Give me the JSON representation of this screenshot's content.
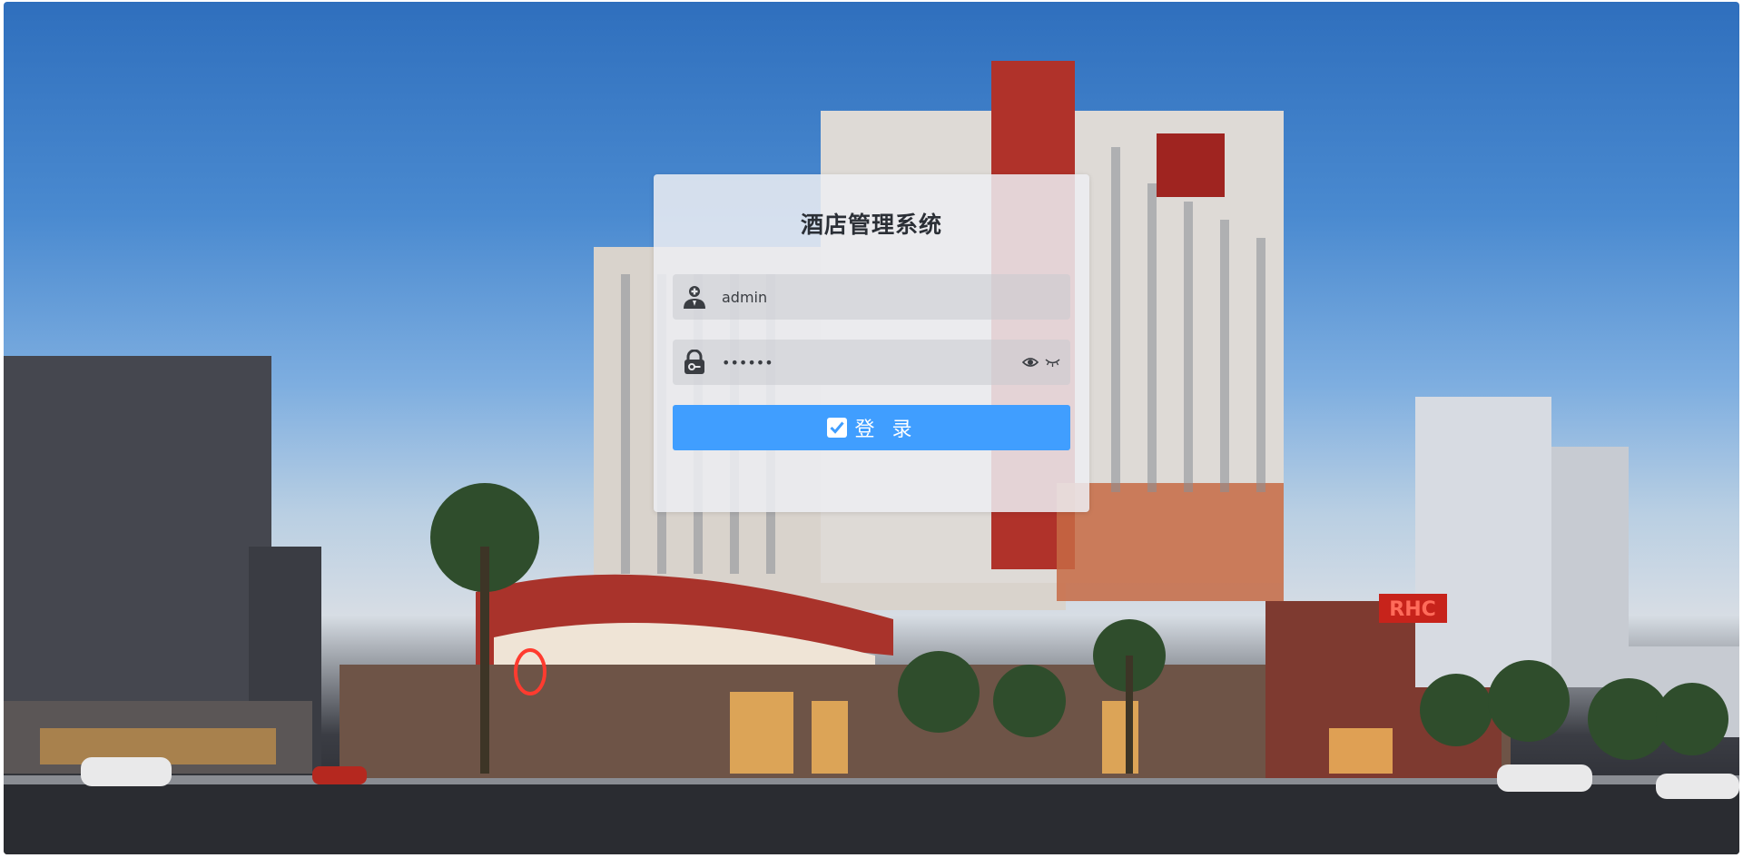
{
  "login": {
    "title": "酒店管理系统",
    "username": {
      "value": "admin",
      "icon": "user-icon"
    },
    "password": {
      "value": "123456",
      "icon": "lock-icon",
      "toggle_icons": [
        "eye-icon",
        "eye-closed-icon"
      ]
    },
    "submit": {
      "label": "登 录",
      "icon": "check-square-icon",
      "color": "#409eff"
    }
  },
  "background": {
    "sign_text": "RHC"
  }
}
